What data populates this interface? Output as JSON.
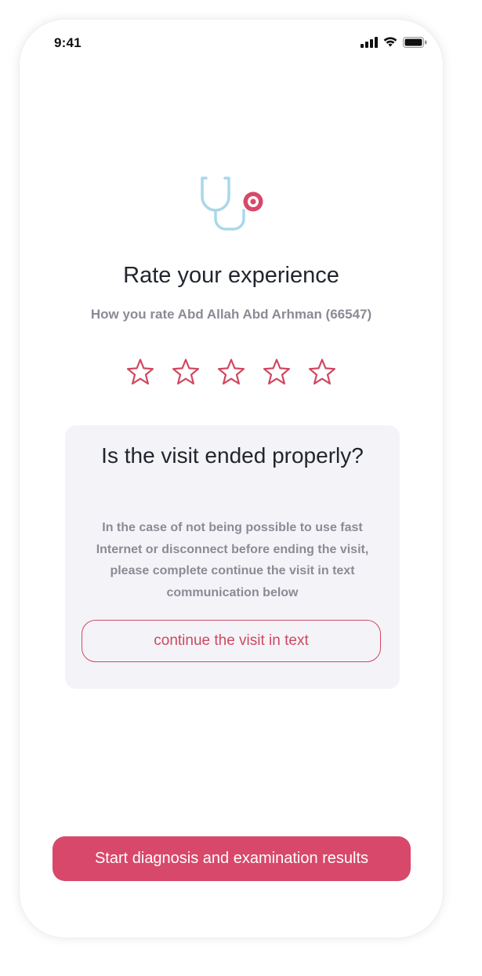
{
  "status_bar": {
    "time": "9:41",
    "icons": [
      "cellular-signal-icon",
      "wifi-icon",
      "battery-icon"
    ]
  },
  "logo": {
    "icon": "stethoscope-icon",
    "colors": {
      "tube": "#a8d8ea",
      "chest_piece": "#d8486a"
    }
  },
  "header": {
    "title": "Rate your experience",
    "subtitle": "How you rate Abd Allah Abd Arhman (66547)"
  },
  "rating": {
    "max": 5,
    "value": 0,
    "star_color": "#d0475f"
  },
  "visit_card": {
    "title": "Is the visit ended properly?",
    "body": "In the case of not being possible to use fast Internet or disconnect before ending the visit, please complete continue the visit in text communication below",
    "button_label": "continue the visit in text"
  },
  "footer": {
    "primary_button_label": "Start diagnosis and examination results"
  },
  "colors": {
    "accent": "#d8486a",
    "text_dark": "#22252f",
    "text_muted": "#8a8b96",
    "card_bg": "#f4f4f8"
  }
}
